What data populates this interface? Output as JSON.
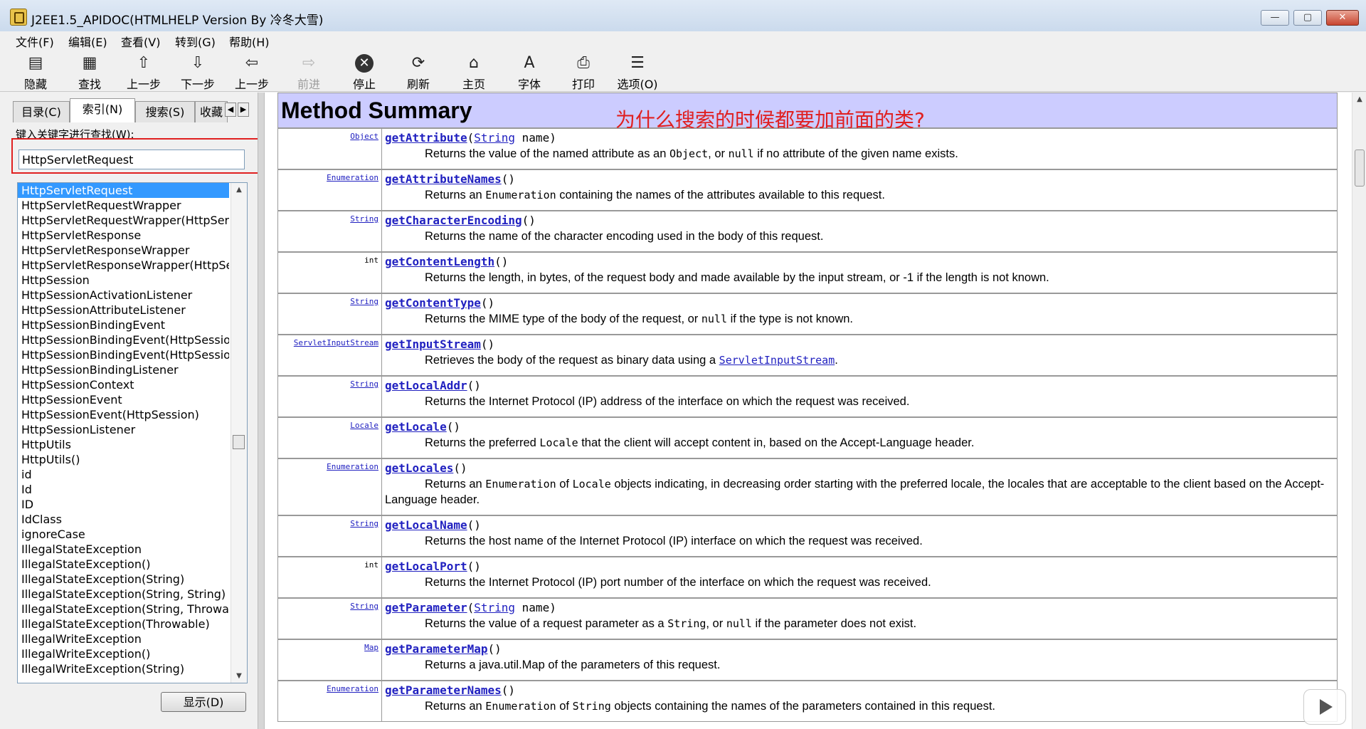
{
  "window": {
    "title": "J2EE1.5_APIDOC(HTMLHELP Version By 冷冬大雪)",
    "buttons": {
      "minimize": "—",
      "maximize": "▢",
      "close": "✕"
    }
  },
  "menu": [
    "文件(F)",
    "编辑(E)",
    "查看(V)",
    "转到(G)",
    "帮助(H)"
  ],
  "toolbar": [
    {
      "label": "隐藏",
      "icon": "hide-icon",
      "glyph": "▤",
      "enabled": true
    },
    {
      "label": "查找",
      "icon": "find-icon",
      "glyph": "▦",
      "enabled": true
    },
    {
      "label": "上一步",
      "icon": "arrow-up-icon",
      "glyph": "⇧",
      "enabled": true
    },
    {
      "label": "下一步",
      "icon": "arrow-down-icon",
      "glyph": "⇩",
      "enabled": true
    },
    {
      "label": "上一步",
      "icon": "back-icon",
      "glyph": "⇦",
      "enabled": true
    },
    {
      "label": "前进",
      "icon": "forward-icon",
      "glyph": "⇨",
      "enabled": false
    },
    {
      "label": "停止",
      "icon": "stop-icon",
      "glyph": "✕",
      "enabled": true
    },
    {
      "label": "刷新",
      "icon": "refresh-icon",
      "glyph": "⟳",
      "enabled": true
    },
    {
      "label": "主页",
      "icon": "home-icon",
      "glyph": "⌂",
      "enabled": true
    },
    {
      "label": "字体",
      "icon": "font-icon",
      "glyph": "A",
      "enabled": true
    },
    {
      "label": "打印",
      "icon": "print-icon",
      "glyph": "⎙",
      "enabled": true
    },
    {
      "label": "选项(O)",
      "icon": "options-icon",
      "glyph": "☰",
      "enabled": true
    }
  ],
  "left": {
    "tabs": [
      "目录(C)",
      "索引(N)",
      "搜索(S)",
      "收藏"
    ],
    "active_tab": 1,
    "keyword_label": "键入关键字进行查找(W):",
    "keyword_value": "HttpServletRequest",
    "selected_index": 0,
    "items": [
      "HttpServletRequest",
      "HttpServletRequestWrapper",
      "HttpServletRequestWrapper(HttpServl",
      "HttpServletResponse",
      "HttpServletResponseWrapper",
      "HttpServletResponseWrapper(HttpSe",
      "HttpSession",
      "HttpSessionActivationListener",
      "HttpSessionAttributeListener",
      "HttpSessionBindingEvent",
      "HttpSessionBindingEvent(HttpSessio",
      "HttpSessionBindingEvent(HttpSessio",
      "HttpSessionBindingListener",
      "HttpSessionContext",
      "HttpSessionEvent",
      "HttpSessionEvent(HttpSession)",
      "HttpSessionListener",
      "HttpUtils",
      "HttpUtils()",
      "id",
      "Id",
      "ID",
      "IdClass",
      "ignoreCase",
      "IllegalStateException",
      "IllegalStateException()",
      "IllegalStateException(String)",
      "IllegalStateException(String, String)",
      "IllegalStateException(String, Throwab",
      "IllegalStateException(Throwable)",
      "IllegalWriteException",
      "IllegalWriteException()",
      "IllegalWriteException(String)"
    ],
    "display_button": "显示(D)"
  },
  "content": {
    "heading": "Method Summary",
    "annotation": "为什么搜索的时候都要加前面的类?",
    "methods": [
      {
        "type": "Object",
        "type_link": true,
        "name": "getAttribute",
        "ptype": "String",
        "pname": " name",
        "desc": [
          [
            "t",
            "Returns the value of the named attribute as an "
          ],
          [
            "c",
            "Object"
          ],
          [
            "t",
            ", or "
          ],
          [
            "c",
            "null"
          ],
          [
            "t",
            " if no attribute of the given name exists."
          ]
        ]
      },
      {
        "type": "Enumeration",
        "type_link": true,
        "name": "getAttributeNames",
        "desc": [
          [
            "t",
            "Returns an "
          ],
          [
            "c",
            "Enumeration"
          ],
          [
            "t",
            " containing the names of the attributes available to this request."
          ]
        ]
      },
      {
        "type": "String",
        "type_link": true,
        "name": "getCharacterEncoding",
        "desc": [
          [
            "t",
            "Returns the name of the character encoding used in the body of this request."
          ]
        ]
      },
      {
        "type": "int",
        "type_link": false,
        "name": "getContentLength",
        "desc": [
          [
            "t",
            "Returns the length, in bytes, of the request body and made available by the input stream, or -1 if the length is not known."
          ]
        ]
      },
      {
        "type": "String",
        "type_link": true,
        "name": "getContentType",
        "desc": [
          [
            "t",
            "Returns the MIME type of the body of the request, or "
          ],
          [
            "c",
            "null"
          ],
          [
            "t",
            " if the type is not known."
          ]
        ]
      },
      {
        "type": "ServletInputStream",
        "type_link": true,
        "name": "getInputStream",
        "desc": [
          [
            "t",
            "Retrieves the body of the request as binary data using a "
          ],
          [
            "l",
            "ServletInputStream"
          ],
          [
            "t",
            "."
          ]
        ]
      },
      {
        "type": "String",
        "type_link": true,
        "name": "getLocalAddr",
        "desc": [
          [
            "t",
            "Returns the Internet Protocol (IP) address of the interface on which the request was received."
          ]
        ]
      },
      {
        "type": "Locale",
        "type_link": true,
        "name": "getLocale",
        "desc": [
          [
            "t",
            "Returns the preferred "
          ],
          [
            "c",
            "Locale"
          ],
          [
            "t",
            " that the client will accept content in, based on the Accept-Language header."
          ]
        ]
      },
      {
        "type": "Enumeration",
        "type_link": true,
        "name": "getLocales",
        "wrap": true,
        "desc": [
          [
            "t",
            "Returns an "
          ],
          [
            "c",
            "Enumeration"
          ],
          [
            "t",
            " of "
          ],
          [
            "c",
            "Locale"
          ],
          [
            "t",
            " objects indicating, in decreasing order starting with the preferred locale, the locales that are acceptable to the client based on the Accept-Language header."
          ]
        ]
      },
      {
        "type": "String",
        "type_link": true,
        "name": "getLocalName",
        "desc": [
          [
            "t",
            "Returns the host name of the Internet Protocol (IP) interface on which the request was received."
          ]
        ]
      },
      {
        "type": "int",
        "type_link": false,
        "name": "getLocalPort",
        "desc": [
          [
            "t",
            "Returns the Internet Protocol (IP) port number of the interface on which the request was received."
          ]
        ]
      },
      {
        "type": "String",
        "type_link": true,
        "name": "getParameter",
        "ptype": "String",
        "pname": " name",
        "desc": [
          [
            "t",
            "Returns the value of a request parameter as a "
          ],
          [
            "c",
            "String"
          ],
          [
            "t",
            ", or "
          ],
          [
            "c",
            "null"
          ],
          [
            "t",
            " if the parameter does not exist."
          ]
        ]
      },
      {
        "type": "Map",
        "type_link": true,
        "name": "getParameterMap",
        "desc": [
          [
            "t",
            "Returns a java.util.Map of the parameters of this request."
          ]
        ]
      },
      {
        "type": "Enumeration",
        "type_link": true,
        "name": "getParameterNames",
        "desc": [
          [
            "t",
            "Returns an "
          ],
          [
            "c",
            "Enumeration"
          ],
          [
            "t",
            " of "
          ],
          [
            "c",
            "String"
          ],
          [
            "t",
            " objects containing the names of the parameters contained in this request."
          ]
        ]
      }
    ]
  }
}
